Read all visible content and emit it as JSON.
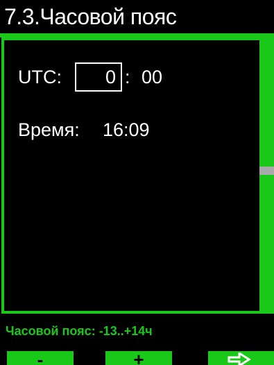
{
  "header": {
    "title": "7.3.Часовой пояс"
  },
  "utc": {
    "label": "UTC:",
    "hours": "0",
    "separator": ":",
    "minutes": "00"
  },
  "time": {
    "label": "Время:",
    "value": "16:09"
  },
  "hint": "Часовой пояс: -13..+14ч",
  "buttons": {
    "minus": "-",
    "plus": "+",
    "next_icon": "arrow-right-icon"
  },
  "scrollbar": {
    "position": 0.5
  },
  "colors": {
    "accent": "#19c819",
    "background": "#000000",
    "text": "#ffffff",
    "scroll_thumb": "#a9a9a9"
  }
}
